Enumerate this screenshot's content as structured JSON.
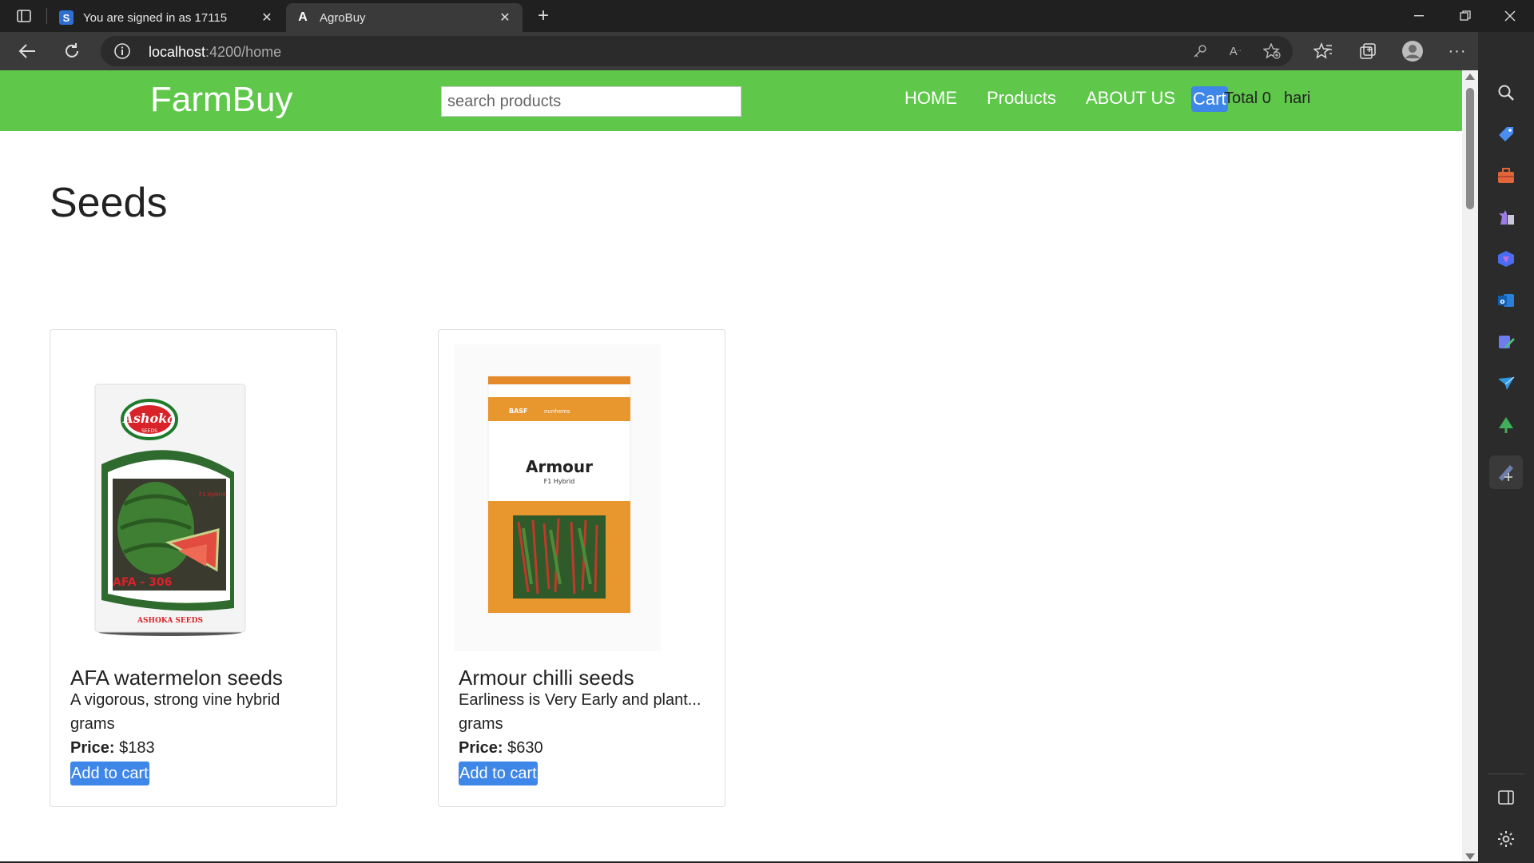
{
  "browser": {
    "tabs": [
      {
        "favicon": "S",
        "title": "You are signed in as 17115",
        "active": false
      },
      {
        "favicon": "A",
        "title": "AgroBuy",
        "active": true
      }
    ],
    "url_host": "localhost",
    "url_path": ":4200/home"
  },
  "navbar": {
    "brand": "FarmBuy",
    "search_placeholder": "search products",
    "links": [
      "HOME",
      "Products",
      "ABOUT US"
    ],
    "cart_label": "Cart",
    "cart_total": "Total 0",
    "user": "hari",
    "accent": "#5fc74a"
  },
  "page": {
    "heading": "Seeds"
  },
  "products": [
    {
      "name": "AFA watermelon seeds",
      "description": "A vigorous, strong vine hybrid",
      "unit": "grams",
      "price_label": "Price:",
      "price": "$183",
      "button": "Add to cart",
      "pack": {
        "brand": "Ashoka",
        "brand_sub": "SEEDS",
        "tag": "F1 Hybrid",
        "variety": "AFA - 306",
        "footer": "ASHOKA SEEDS"
      }
    },
    {
      "name": "Armour chilli seeds",
      "description": "Earliness is Very Early and plant...",
      "unit": "grams",
      "price_label": "Price:",
      "price": "$630",
      "button": "Add to cart",
      "pack": {
        "brand": "BASF",
        "sub_brand": "nunhems",
        "variety": "Armour",
        "tag": "F1 Hybrid"
      }
    }
  ],
  "colors": {
    "button_blue": "#3e86e8",
    "nav_green": "#5fc74a"
  }
}
